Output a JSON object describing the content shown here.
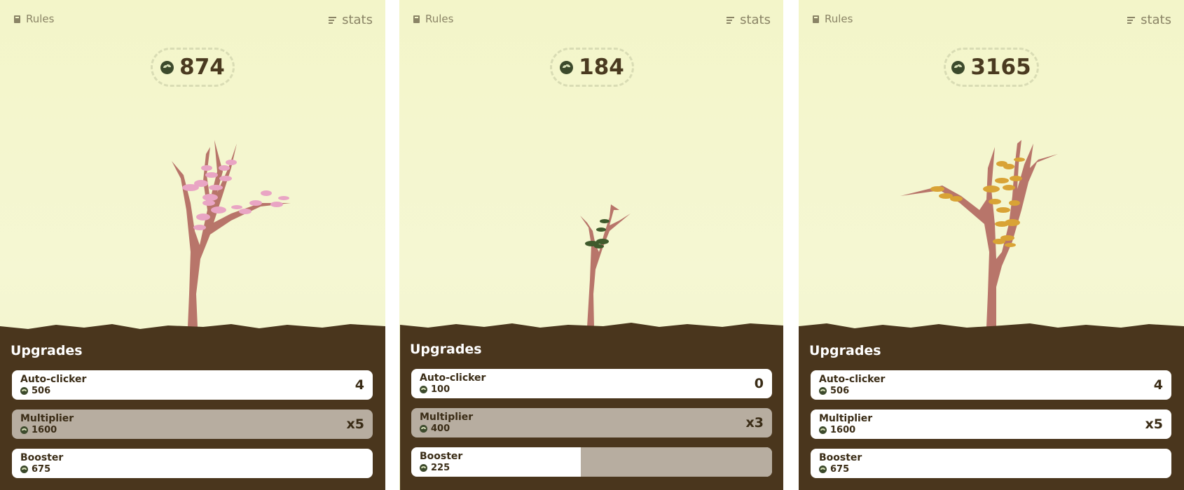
{
  "panels": [
    {
      "rules_label": "Rules",
      "stats_label": "stats",
      "seeds": "874",
      "upgrades_title": "Upgrades",
      "upgrades": [
        {
          "name": "Auto-clicker",
          "cost": "506",
          "level": "4"
        },
        {
          "name": "Multiplier",
          "cost": "1600",
          "level": "x5"
        },
        {
          "name": "Booster",
          "cost": "675",
          "level": ""
        }
      ],
      "leaf_color": "#e9a5c4"
    },
    {
      "rules_label": "Rules",
      "stats_label": "stats",
      "seeds": "184",
      "upgrades_title": "Upgrades",
      "upgrades": [
        {
          "name": "Auto-clicker",
          "cost": "100",
          "level": "0"
        },
        {
          "name": "Multiplier",
          "cost": "400",
          "level": "x3"
        },
        {
          "name": "Booster",
          "cost": "225",
          "level": "",
          "progress": 0.47
        }
      ],
      "leaf_color": "#3f5a2c"
    },
    {
      "rules_label": "Rules",
      "stats_label": "stats",
      "seeds": "3165",
      "upgrades_title": "Upgrades",
      "upgrades": [
        {
          "name": "Auto-clicker",
          "cost": "506",
          "level": "4"
        },
        {
          "name": "Multiplier",
          "cost": "1600",
          "level": "x5"
        },
        {
          "name": "Booster",
          "cost": "675",
          "level": ""
        }
      ],
      "leaf_color": "#d9a335"
    }
  ],
  "colors": {
    "sky": "#f3f5c9",
    "soil": "#4a361d",
    "bark": "#b8756a",
    "card": "#ffffff",
    "card_disabled": "#b7ada0"
  }
}
